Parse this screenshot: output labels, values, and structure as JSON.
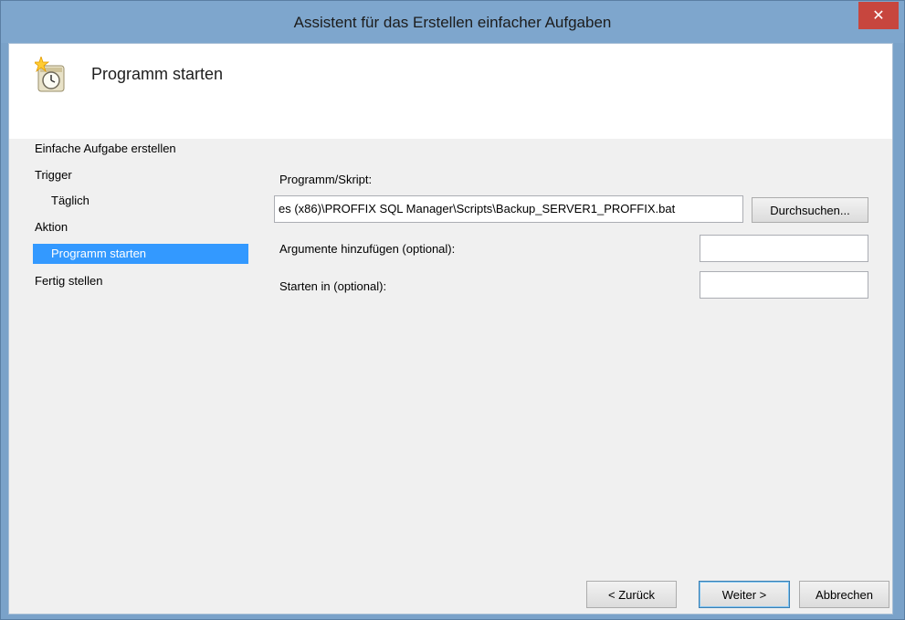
{
  "window": {
    "title": "Assistent für das Erstellen einfacher Aufgaben",
    "close_symbol": "✕"
  },
  "header": {
    "icon": "task-scheduler-clock-icon",
    "title": "Programm starten"
  },
  "nav": {
    "items": [
      {
        "label": "Einfache Aufgabe erstellen",
        "indent": 0,
        "selected": false
      },
      {
        "label": "Trigger",
        "indent": 0,
        "selected": false
      },
      {
        "label": "Täglich",
        "indent": 1,
        "selected": false
      },
      {
        "label": "Aktion",
        "indent": 0,
        "selected": false
      },
      {
        "label": "Programm starten",
        "indent": 1,
        "selected": true
      },
      {
        "label": "Fertig stellen",
        "indent": 0,
        "selected": false
      }
    ]
  },
  "form": {
    "program_label": "Programm/Skript:",
    "program_value": "es (x86)\\PROFFIX SQL Manager\\Scripts\\Backup_SERVER1_PROFFIX.bat",
    "browse_label": "Durchsuchen...",
    "arguments_label": "Argumente hinzufügen (optional):",
    "arguments_value": "",
    "start_in_label": "Starten in (optional):",
    "start_in_value": ""
  },
  "footer": {
    "back_label": "< Zurück",
    "next_label": "Weiter >",
    "cancel_label": "Abbrechen"
  },
  "colors": {
    "title_bar": "#7ea6cd",
    "close_button": "#c7463e",
    "selection": "#3399ff",
    "dialog_background": "#f0f0f0"
  }
}
